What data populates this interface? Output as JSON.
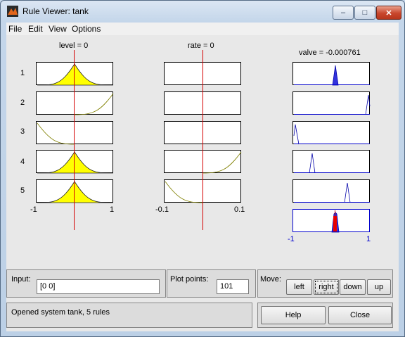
{
  "window": {
    "title": "Rule Viewer: tank",
    "controls": {
      "minimize": "–",
      "maximize": "□",
      "close": "✕"
    }
  },
  "menu": [
    "File",
    "Edit",
    "View",
    "Options"
  ],
  "columns": {
    "level": {
      "header": "level = 0",
      "axis_min": "-1",
      "axis_max": "1"
    },
    "rate": {
      "header": "rate = 0",
      "axis_min": "-0.1",
      "axis_max": "0.1"
    },
    "valve": {
      "header": "valve = -0.000761",
      "axis_min": "-1",
      "axis_max": "1"
    }
  },
  "rules": [
    "1",
    "2",
    "3",
    "4",
    "5"
  ],
  "input": {
    "label": "Input:",
    "value": "[0 0]"
  },
  "plot_points": {
    "label": "Plot points:",
    "value": "101"
  },
  "move": {
    "label": "Move:",
    "left": "left",
    "right": "right",
    "down": "down",
    "up": "up"
  },
  "status": "Opened system tank, 5 rules",
  "buttons": {
    "help": "Help",
    "close": "Close"
  },
  "colors": {
    "fill": "#ffff00",
    "line": "#d40000",
    "output": "#0000cc"
  }
}
